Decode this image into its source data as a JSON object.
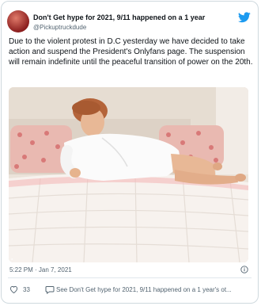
{
  "author": {
    "name": "Don't Get hype for 2021, 9/11 happened on a 1 year",
    "handle": "@Pickuptruckdude"
  },
  "tweet": {
    "text": "Due to the violent protest in D.C yesterday we have decided to take action and suspend the President's Onlyfans page. The suspension will remain indefinite until the peaceful transition of power on the 20th.",
    "timestamp": "5:22 PM · Jan 7, 2021"
  },
  "footer": {
    "likes": "33",
    "reply_text": "See Don't Get hype for 2021, 9/11 happened on a 1 year's ot..."
  },
  "icons": {
    "brand": "twitter-bird-icon",
    "info": "info-icon",
    "like": "heart-icon",
    "reply": "reply-icon"
  },
  "colors": {
    "brand": "#1d9bf0",
    "secondary_text": "#536471",
    "border": "#cfd9de"
  }
}
